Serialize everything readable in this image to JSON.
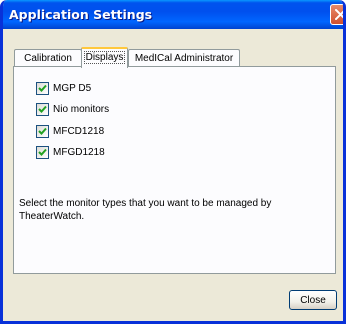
{
  "window": {
    "title": "Application Settings"
  },
  "tabs": [
    {
      "label": "Calibration"
    },
    {
      "label": "Displays"
    },
    {
      "label": "MedICal Administrator"
    }
  ],
  "active_tab": "Displays",
  "displays": {
    "options": [
      {
        "label": "MGP D5",
        "checked": true
      },
      {
        "label": "Nio monitors",
        "checked": true
      },
      {
        "label": "MFCD1218",
        "checked": true
      },
      {
        "label": "MFGD1218",
        "checked": true
      }
    ],
    "description": "Select the monitor types that you want to be managed by TheaterWatch."
  },
  "buttons": {
    "close_label": "Close"
  },
  "colors": {
    "titlebar": "#0054e3",
    "window_frame": "#0831d9",
    "dialog_bg": "#ece9d8",
    "checkmark": "#21a121",
    "close_x_bg": "#d1502e"
  }
}
